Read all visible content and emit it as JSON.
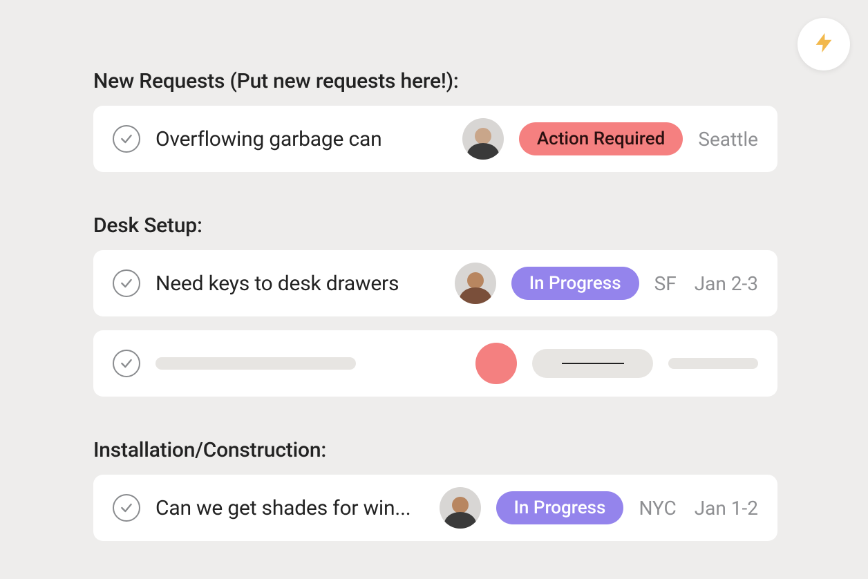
{
  "fab": {
    "icon": "lightning-icon"
  },
  "sections": [
    {
      "title": "New Requests (Put new requests here!):",
      "tasks": [
        {
          "title": "Overflowing garbage can",
          "status": {
            "label": "Action Required",
            "kind": "action"
          },
          "location": "Seattle",
          "date": "",
          "avatar": "person-1"
        }
      ]
    },
    {
      "title": "Desk Setup:",
      "tasks": [
        {
          "title": "Need keys to desk drawers",
          "status": {
            "label": "In Progress",
            "kind": "progress"
          },
          "location": "SF",
          "date": "Jan 2-3",
          "avatar": "person-2"
        },
        {
          "skeleton": true
        }
      ]
    },
    {
      "title": "Installation/Construction:",
      "tasks": [
        {
          "title": "Can we get shades for win...",
          "status": {
            "label": "In Progress",
            "kind": "progress"
          },
          "location": "NYC",
          "date": "Jan 1-2",
          "avatar": "person-3"
        }
      ]
    }
  ]
}
